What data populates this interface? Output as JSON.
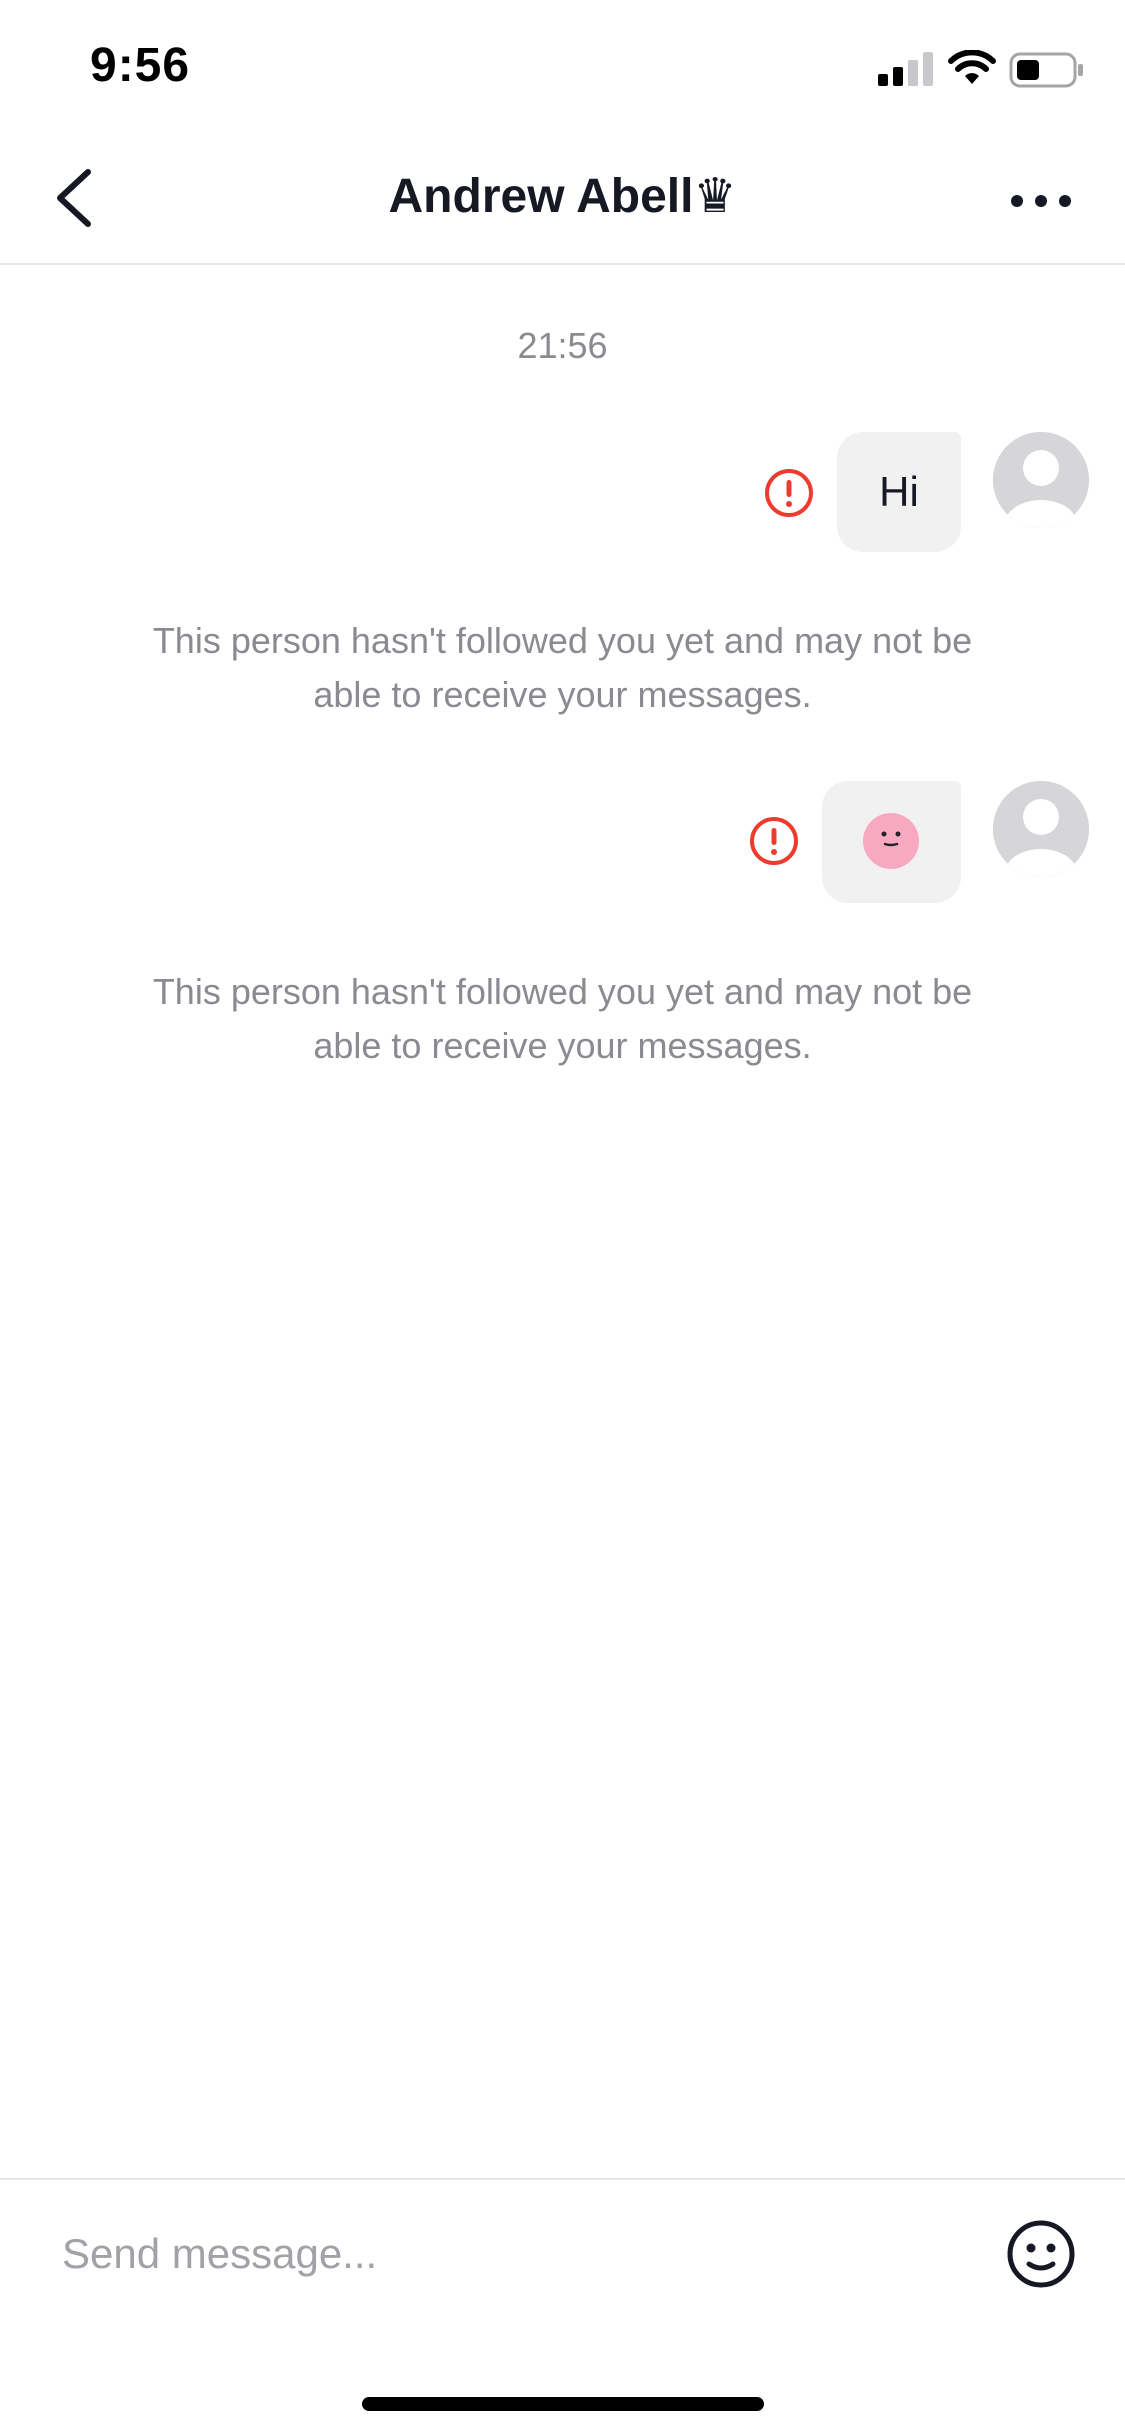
{
  "status_bar": {
    "time": "9:56",
    "icons": [
      "signal-icon",
      "wifi-icon",
      "battery-icon"
    ]
  },
  "header": {
    "title": "Andrew Abell♛",
    "back_icon": "back-arrow-icon",
    "more_icon": "more-options-icon"
  },
  "chat": {
    "timestamp": "21:56",
    "messages": [
      {
        "type": "text",
        "text": "Hi",
        "status_icon": "error-icon",
        "notice": "This person hasn't followed you yet and may not be able to receive your messages."
      },
      {
        "type": "sticker",
        "sticker_icon": "pink-face-sticker",
        "status_icon": "error-icon",
        "notice": "This person hasn't followed you yet and may not be able to receive your messages."
      }
    ]
  },
  "composer": {
    "placeholder": "Send message...",
    "emoji_icon": "emoji-icon"
  },
  "colors": {
    "error": "#ee3b2f",
    "bubble": "#f1f1f2",
    "muted_text": "#8a8b91",
    "sticker": "#f9a8c1"
  }
}
